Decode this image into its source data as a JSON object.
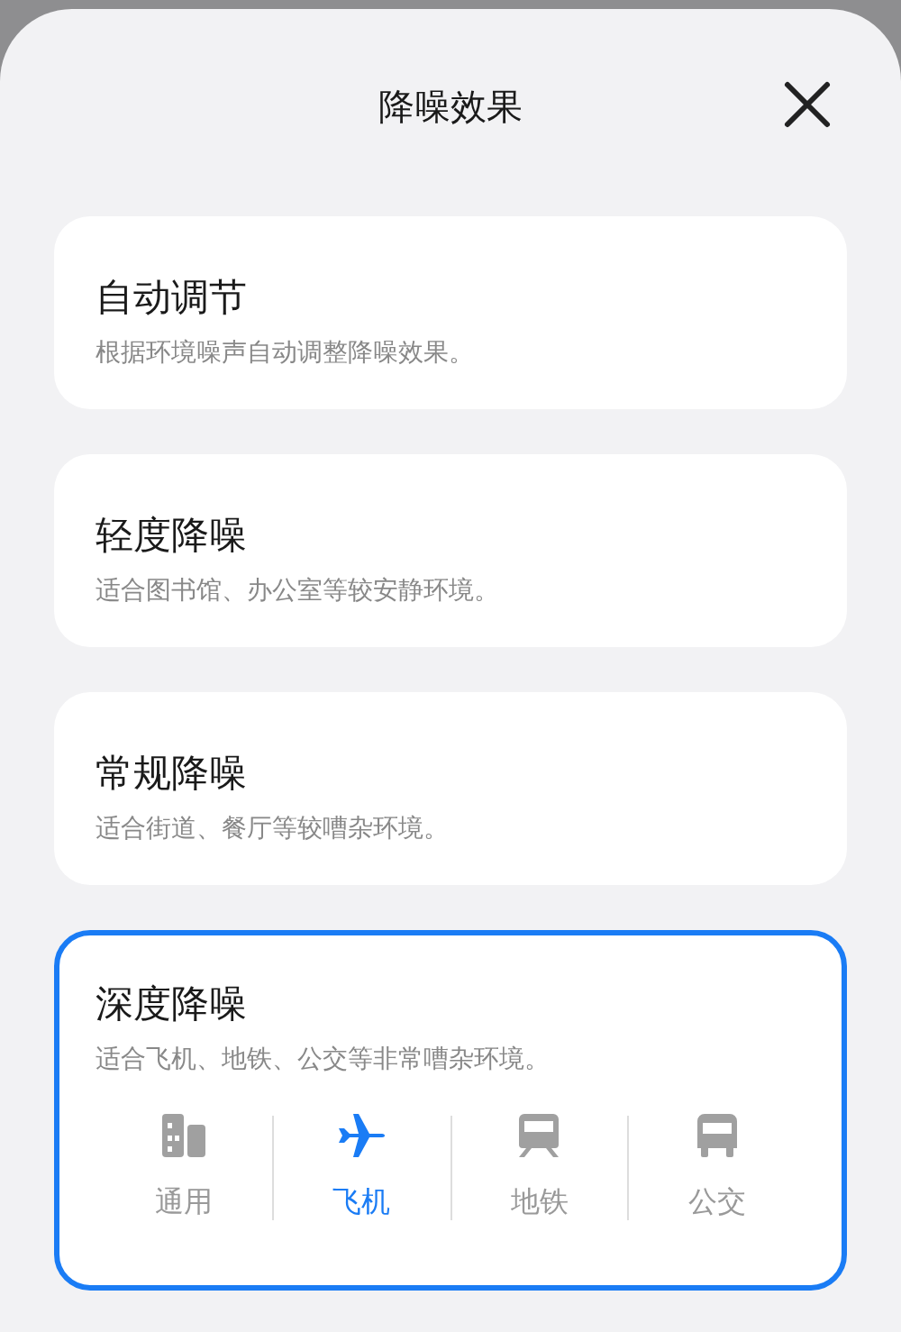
{
  "title": "降噪效果",
  "options": [
    {
      "name": "自动调节",
      "description": "根据环境噪声自动调整降噪效果。",
      "selected": false
    },
    {
      "name": "轻度降噪",
      "description": "适合图书馆、办公室等较安静环境。",
      "selected": false
    },
    {
      "name": "常规降噪",
      "description": "适合街道、餐厅等较嘈杂环境。",
      "selected": false
    },
    {
      "name": "深度降噪",
      "description": "适合飞机、地铁、公交等非常嘈杂环境。",
      "selected": true,
      "modes": [
        {
          "kind": "building",
          "label": "通用",
          "selected": false
        },
        {
          "kind": "plane",
          "label": "飞机",
          "selected": true
        },
        {
          "kind": "subway",
          "label": "地铁",
          "selected": false
        },
        {
          "kind": "bus",
          "label": "公交",
          "selected": false
        }
      ]
    }
  ]
}
